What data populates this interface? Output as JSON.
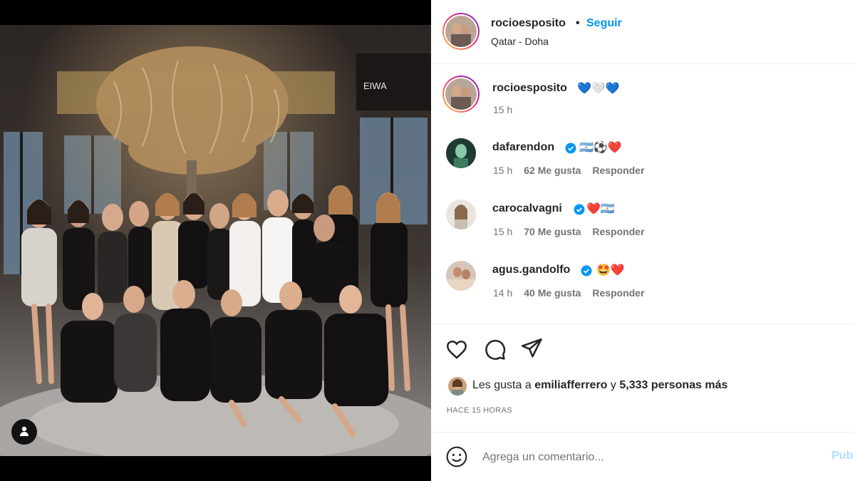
{
  "post": {
    "author": "rocioesposito",
    "follow_label": "Seguir",
    "separator": "•",
    "location": "Qatar - Doha"
  },
  "caption": {
    "author": "rocioesposito",
    "text": "💙🤍💙",
    "time": "15 h"
  },
  "comments": [
    {
      "user": "dafarendon",
      "verified": true,
      "text": "🇦🇷⚽❤️",
      "time": "15 h",
      "likes": "62 Me gusta",
      "reply": "Responder"
    },
    {
      "user": "carocalvagni",
      "verified": true,
      "text": "❤️🇦🇷",
      "time": "15 h",
      "likes": "70 Me gusta",
      "reply": "Responder"
    },
    {
      "user": "agus.gandolfo",
      "verified": true,
      "text": "🤩❤️",
      "time": "14 h",
      "likes": "40 Me gusta",
      "reply": "Responder"
    }
  ],
  "likes": {
    "prefix": "Les gusta a",
    "user": "emiliafferrero",
    "connector": "y",
    "others": "5,333 personas más"
  },
  "timestamp": "HACE 15 HORAS",
  "comment_box": {
    "placeholder": "Agrega un comentario...",
    "publish_label": "Pub"
  },
  "icons": {
    "like": "heart-icon",
    "comment": "comment-bubble-icon",
    "share": "paper-plane-icon",
    "emoji": "smiley-icon",
    "tag": "user-tag-icon",
    "verified": "verified-badge-icon"
  },
  "colors": {
    "accent": "#0095f6",
    "verified": "#0095f6",
    "publish_disabled": "#b2dffc",
    "muted": "#737373"
  }
}
